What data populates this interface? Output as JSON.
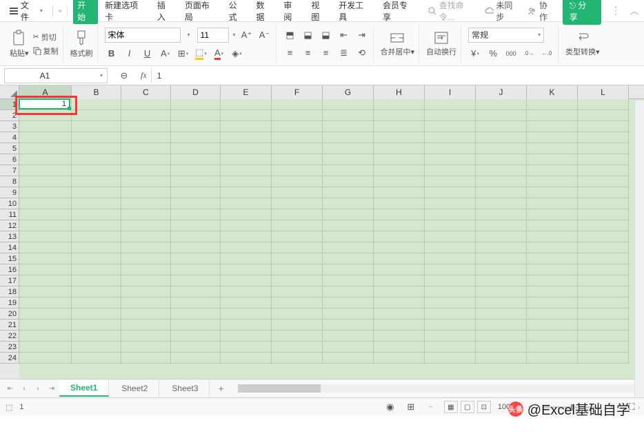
{
  "menubar": {
    "file": "文件",
    "tabs": [
      "开始",
      "新建选项卡",
      "插入",
      "页面布局",
      "公式",
      "数据",
      "审阅",
      "视图",
      "开发工具",
      "会员专享"
    ],
    "search_ph": "查找命令...",
    "unsync": "未同步",
    "coop": "协作",
    "share": "分享"
  },
  "ribbon": {
    "paste": "粘贴",
    "cut": "剪切",
    "copy": "复制",
    "format_painter": "格式刷",
    "font_name": "宋体",
    "font_size": "11",
    "merge": "合并居中",
    "wrap": "自动换行",
    "num_format": "常规",
    "type_conv": "类型转换"
  },
  "formula_bar": {
    "namebox": "A1",
    "value": "1"
  },
  "grid": {
    "columns": [
      "A",
      "B",
      "C",
      "D",
      "E",
      "F",
      "G",
      "H",
      "I",
      "J",
      "K",
      "L"
    ],
    "rows": 24,
    "active": {
      "col": 0,
      "row": 0,
      "value": "1"
    }
  },
  "sheets": {
    "tabs": [
      "Sheet1",
      "Sheet2",
      "Sheet3"
    ],
    "active": 0
  },
  "status": {
    "value": "1",
    "zoom": "100%"
  },
  "watermark": {
    "prefix": "头条",
    "text": "@Excel基础自学"
  }
}
